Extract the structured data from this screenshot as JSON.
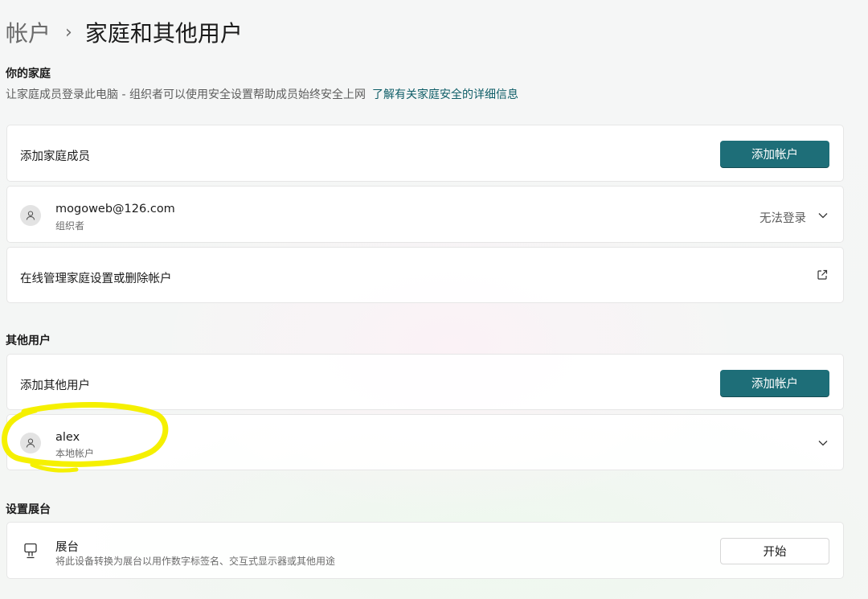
{
  "breadcrumb": {
    "parent": "帐户",
    "separator": "›",
    "title": "家庭和其他用户"
  },
  "family": {
    "heading": "你的家庭",
    "description": "让家庭成员登录此电脑 - 组织者可以使用安全设置帮助成员始终安全上网",
    "link": "了解有关家庭安全的详细信息",
    "add_member_label": "添加家庭成员",
    "add_button": "添加帐户",
    "member": {
      "name": "mogoweb@126.com",
      "role": "组织者",
      "status": "无法登录"
    },
    "manage_label": "在线管理家庭设置或删除帐户"
  },
  "other_users": {
    "heading": "其他用户",
    "add_label": "添加其他用户",
    "add_button": "添加帐户",
    "user": {
      "name": "alex",
      "type": "本地帐户"
    }
  },
  "kiosk": {
    "heading": "设置展台",
    "title": "展台",
    "description": "将此设备转换为展台以用作数字标签名、交互式显示器或其他用途",
    "button": "开始"
  },
  "colors": {
    "accent": "#1e6e78",
    "link": "#0f5e68",
    "highlight": "#f5f000"
  },
  "icons": [
    "person-icon",
    "chevron-down-icon",
    "open-external-icon",
    "kiosk-icon"
  ]
}
